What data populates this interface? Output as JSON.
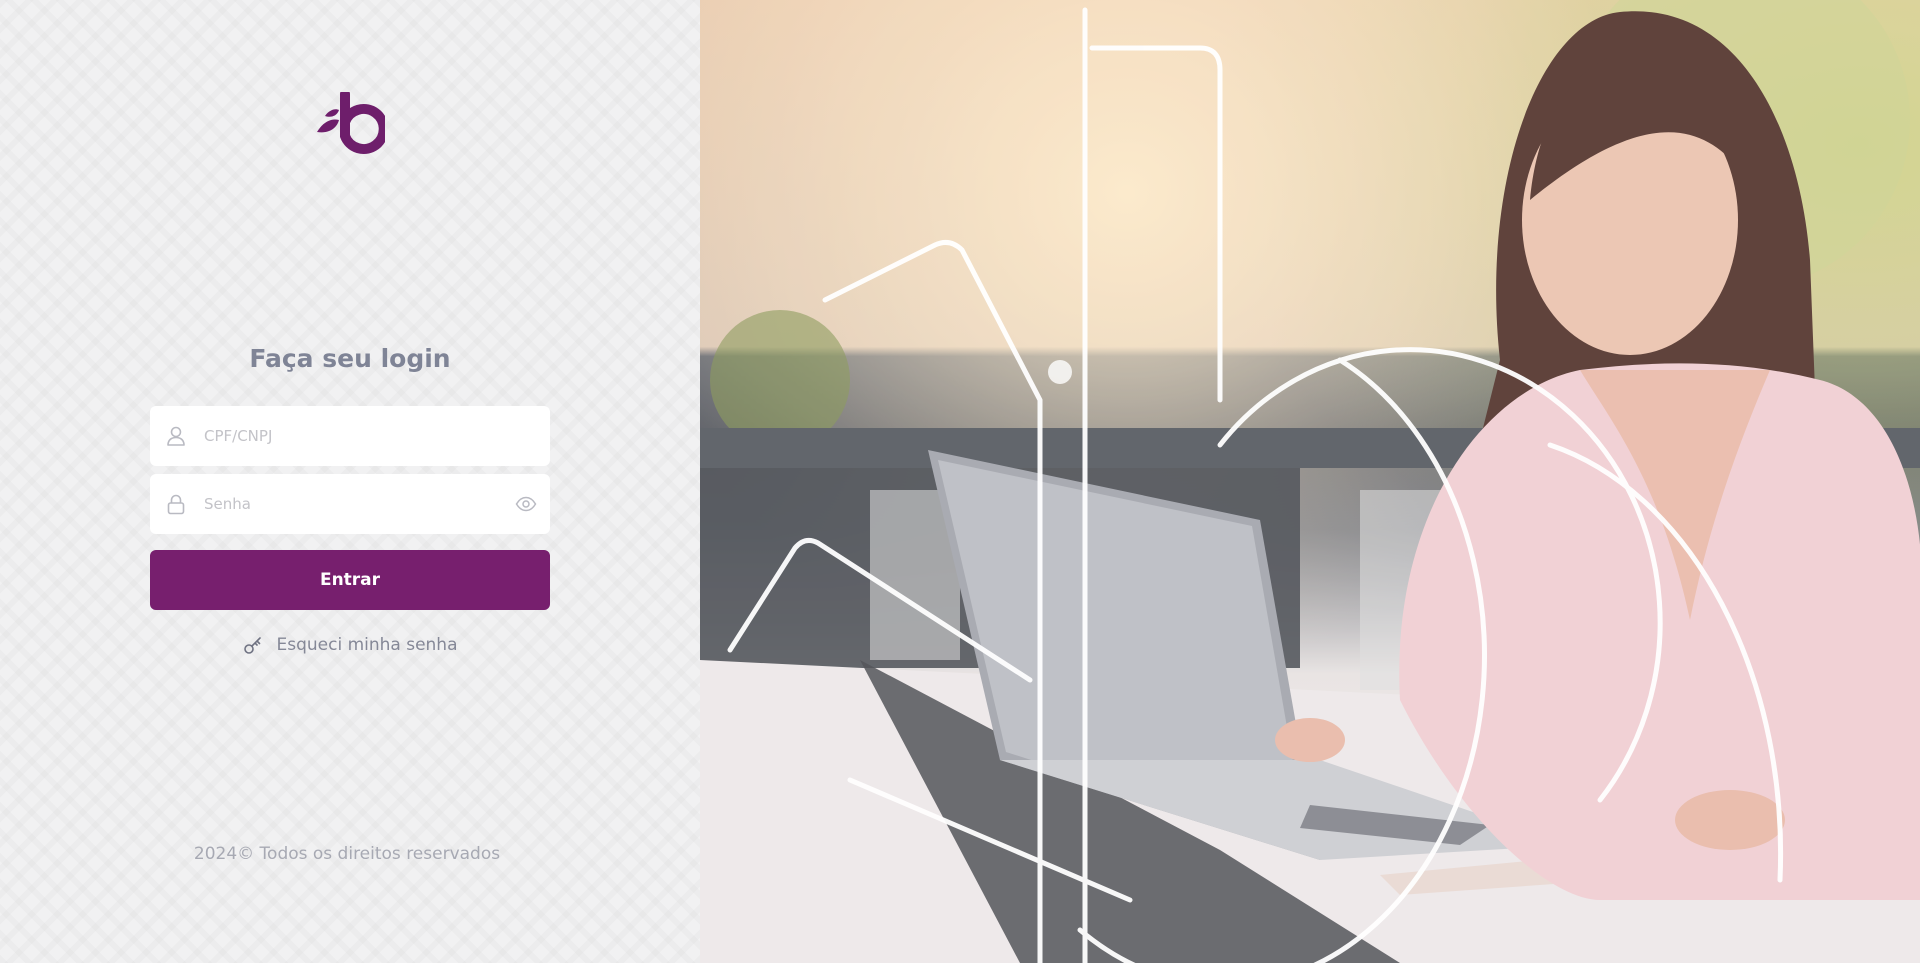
{
  "login": {
    "title": "Faça seu login",
    "cpf_placeholder": "CPF/CNPJ",
    "password_placeholder": "Senha",
    "submit_label": "Entrar",
    "forgot_label": "Esqueci minha senha"
  },
  "footer": {
    "copyright": "2024© Todos os direitos reservados"
  },
  "brand": {
    "logo_icon": "brand-b-logo",
    "primary_color": "#771f6e"
  },
  "icons": {
    "user": "user-icon",
    "lock": "lock-icon",
    "eye": "eye-icon",
    "key": "key-icon"
  }
}
